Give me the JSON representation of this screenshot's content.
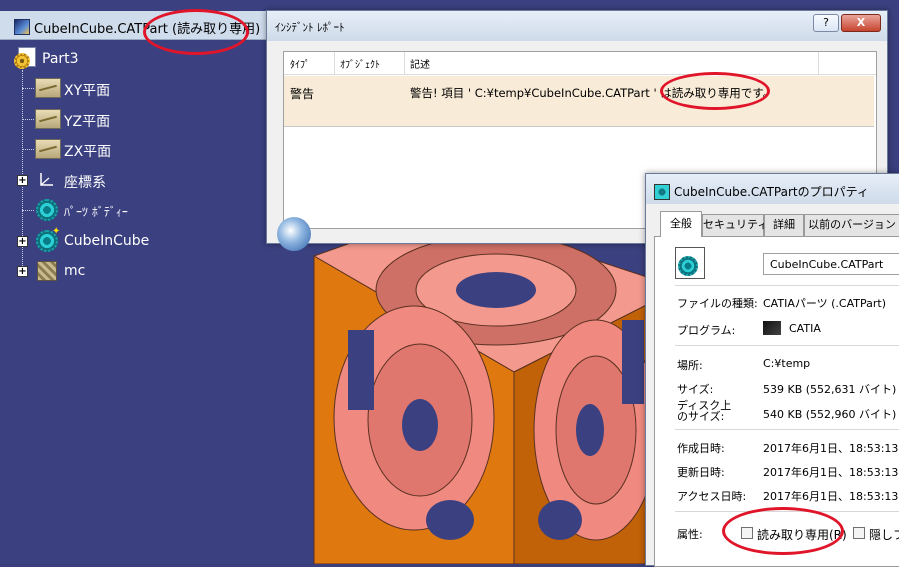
{
  "catia": {
    "title": "CubeInCube.CATPart (読み取り専用)",
    "tree": {
      "root": "Part3",
      "items": [
        {
          "label": "XY平面"
        },
        {
          "label": "YZ平面"
        },
        {
          "label": "ZX平面"
        },
        {
          "label": "座標系"
        },
        {
          "label": "ﾊﾟｰﾂ ﾎﾞﾃﾞｨｰ"
        },
        {
          "label": "CubeInCube"
        },
        {
          "label": "mc"
        }
      ]
    }
  },
  "incident": {
    "title": "ｲﾝｼﾃﾞﾝﾄ ﾚﾎﾟｰﾄ",
    "help_label": "?",
    "close_label": "X",
    "columns": [
      "ﾀｲﾌﾟ",
      "ｵﾌﾞｼﾞｪｸﾄ",
      "記述"
    ],
    "rows": [
      {
        "type": "警告",
        "object": "",
        "description": "警告! 項目 ' C:¥temp¥CubeInCube.CATPart ' は読み取り専用です。"
      }
    ]
  },
  "properties": {
    "title": "CubeInCube.CATPartのプロパティ",
    "tabs": [
      "全般",
      "セキュリティ",
      "詳細",
      "以前のバージョン"
    ],
    "filename": "CubeInCube.CATPart",
    "fields": [
      {
        "label": "ファイルの種類:",
        "value": "CATIAパーツ (.CATPart)"
      },
      {
        "label": "プログラム:",
        "value": "CATIA"
      },
      {
        "label": "場所:",
        "value": "C:¥temp"
      },
      {
        "label": "サイズ:",
        "value": "539 KB (552,631 バイト)"
      },
      {
        "label": "ディスク上\nのサイズ:",
        "value": "540 KB (552,960 バイト)"
      },
      {
        "label": "作成日時:",
        "value": "2017年6月1日、18:53:13"
      },
      {
        "label": "更新日時:",
        "value": "2017年6月1日、18:53:13"
      },
      {
        "label": "アクセス日時:",
        "value": "2017年6月1日、18:53:13"
      }
    ],
    "attributes_label": "属性:",
    "readonly_label": "読み取り専用(R)",
    "hidden_label": "隠しファ"
  },
  "colors": {
    "annotation": "#e0152a",
    "cube_orange": "#e07810",
    "cube_pink": "#f08a80",
    "viewport": "#3b4080"
  }
}
